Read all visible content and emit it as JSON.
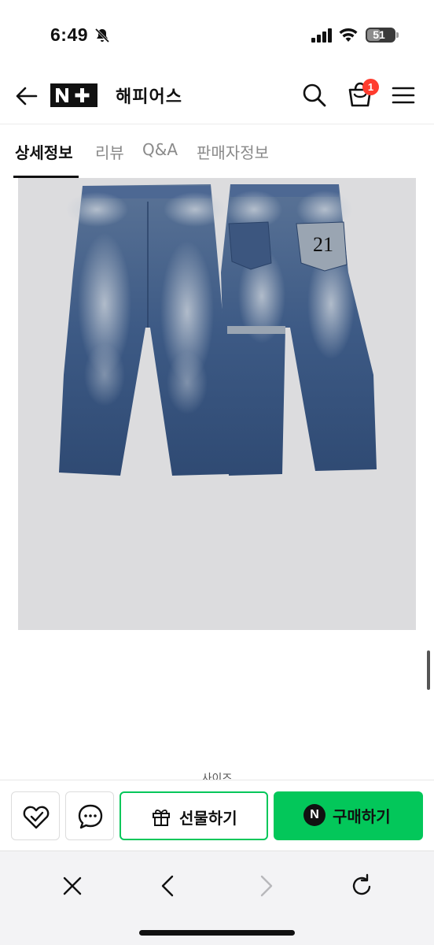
{
  "status_bar": {
    "time": "6:49",
    "battery_percent": "51",
    "battery_level": 0.51
  },
  "header": {
    "logo_text": "N+",
    "store_name": "해피어스",
    "cart_count": "1",
    "icons": [
      "back-arrow-icon",
      "search-icon",
      "cart-icon",
      "menu-icon"
    ]
  },
  "tabs": [
    {
      "label": "상세정보",
      "active": true
    },
    {
      "label": "리뷰",
      "active": false
    },
    {
      "label": "Q&A",
      "active": false
    },
    {
      "label": "판매자정보",
      "active": false
    }
  ],
  "product_image": {
    "back_pocket_number": "21"
  },
  "section_label_partial": "사이즈",
  "action_bar": {
    "gift_label": "선물하기",
    "buy_label": "구매하기",
    "buy_icon_letter": "N",
    "icons": [
      "zzim-heart-icon",
      "chat-bubble-icon",
      "gift-icon",
      "naver-pay-icon"
    ]
  },
  "browser_bar": {
    "icons": [
      "close-icon",
      "back-chevron-icon",
      "forward-chevron-icon",
      "reload-icon"
    ]
  },
  "colors": {
    "brand_green": "#03c75a",
    "badge_red": "#ff3c2e",
    "image_bg": "#dcdcde"
  }
}
